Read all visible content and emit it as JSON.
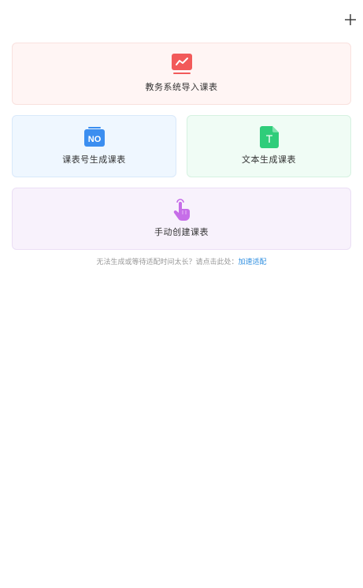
{
  "header": {
    "add_icon": "plus-icon"
  },
  "options": {
    "import": {
      "label": "教务系统导入课表",
      "icon": "chart-board-icon",
      "color": "#f25a5a"
    },
    "course_no": {
      "label": "课表号生成课表",
      "icon": "no-badge-icon",
      "icon_text": "NO",
      "color": "#3b8ef0"
    },
    "text": {
      "label": "文本生成课表",
      "icon": "text-document-icon",
      "icon_text": "T",
      "color": "#2fcd7a"
    },
    "manual": {
      "label": "手动创建课表",
      "icon": "tap-hand-icon",
      "color": "#c66ee8"
    }
  },
  "hint": {
    "text": "无法生成或等待适配时间太长？请点击此处：",
    "link": "加速适配"
  }
}
